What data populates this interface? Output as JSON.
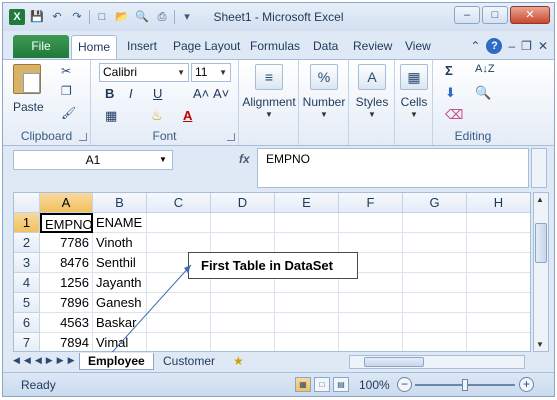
{
  "window": {
    "title": "Sheet1 - Microsoft Excel",
    "excel_icon": "excel-app-icon",
    "qat_icons": [
      "save-icon",
      "undo-icon",
      "redo-icon",
      "new-icon",
      "open-icon",
      "print-preview-icon",
      "quick-print-icon",
      "customize-icon"
    ]
  },
  "tabs": {
    "file": "File",
    "items": [
      "Home",
      "Insert",
      "Page Layout",
      "Formulas",
      "Data",
      "Review",
      "View"
    ],
    "active": "Home"
  },
  "ribbon": {
    "clipboard": {
      "paste": "Paste",
      "group": "Clipboard"
    },
    "font": {
      "family": "Calibri",
      "size": "11",
      "bold": "B",
      "italic": "I",
      "underline": "U",
      "grow": "A˄",
      "shrink": "A˅",
      "group": "Font"
    },
    "alignment": {
      "label": "Alignment"
    },
    "number": {
      "label": "Number",
      "icon_text": "%"
    },
    "styles": {
      "label": "Styles",
      "icon_text": "A"
    },
    "cells": {
      "label": "Cells"
    },
    "editing": {
      "group": "Editing",
      "sum": "Σ",
      "sort": "A↓Z"
    },
    "accent_color": "#1f7a3b"
  },
  "formula_bar": {
    "name_box": "A1",
    "fx": "fx",
    "value": "EMPNO"
  },
  "grid": {
    "columns": [
      "A",
      "B",
      "C",
      "D",
      "E",
      "F",
      "G",
      "H"
    ],
    "selected_column": "A",
    "rows": [
      {
        "n": "1",
        "a": "EMPNO",
        "b": "ENAME"
      },
      {
        "n": "2",
        "a": "7786",
        "b": "Vinoth"
      },
      {
        "n": "3",
        "a": "8476",
        "b": "Senthil"
      },
      {
        "n": "4",
        "a": "1256",
        "b": "Jayanth"
      },
      {
        "n": "5",
        "a": "7896",
        "b": "Ganesh"
      },
      {
        "n": "6",
        "a": "4563",
        "b": "Baskar"
      },
      {
        "n": "7",
        "a": "7894",
        "b": "Vimal"
      }
    ]
  },
  "callout": "First Table in DataSet",
  "sheets": {
    "tabs": [
      "Employee",
      "Customer"
    ],
    "active": "Employee"
  },
  "status": {
    "ready": "Ready",
    "zoom": "100%",
    "zoom_fraction": 0.5
  }
}
